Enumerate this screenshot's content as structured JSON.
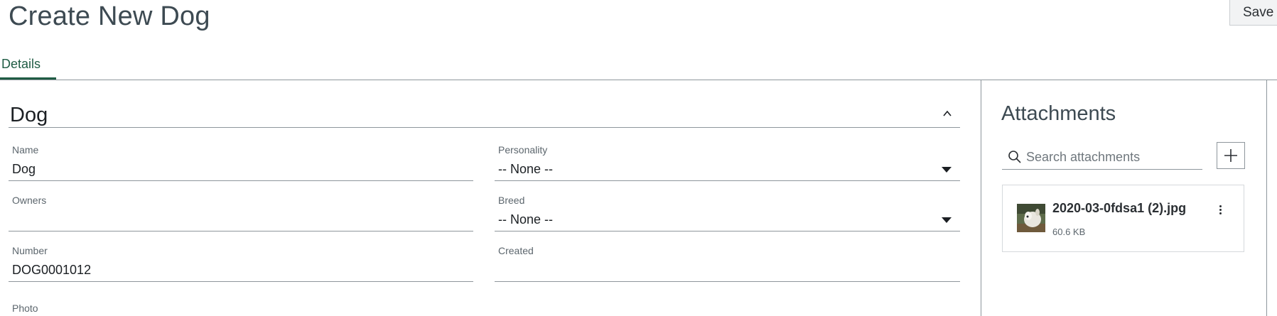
{
  "page": {
    "title": "Create New Dog"
  },
  "toolbar": {
    "save_label": "Save"
  },
  "tabs": [
    {
      "label": "Details",
      "active": true
    }
  ],
  "section": {
    "title": "Dog",
    "collapse_icon": "chevron-up-icon"
  },
  "fields": {
    "name": {
      "label": "Name",
      "value": "Dog"
    },
    "personality": {
      "label": "Personality",
      "value": "-- None --"
    },
    "owners": {
      "label": "Owners",
      "value": ""
    },
    "breed": {
      "label": "Breed",
      "value": "-- None --"
    },
    "number": {
      "label": "Number",
      "value": "DOG0001012"
    },
    "created": {
      "label": "Created",
      "value": ""
    },
    "photo": {
      "label": "Photo"
    }
  },
  "attachments": {
    "title": "Attachments",
    "search_placeholder": "Search attachments",
    "add_icon": "plus-icon",
    "items": [
      {
        "name": "2020-03-0fdsa1 (2).jpg",
        "size": "60.6 KB",
        "menu_icon": "more-vertical-icon"
      }
    ]
  },
  "colors": {
    "accent": "#1f5c44",
    "title": "#3d4a52",
    "divider": "#8e969c"
  }
}
